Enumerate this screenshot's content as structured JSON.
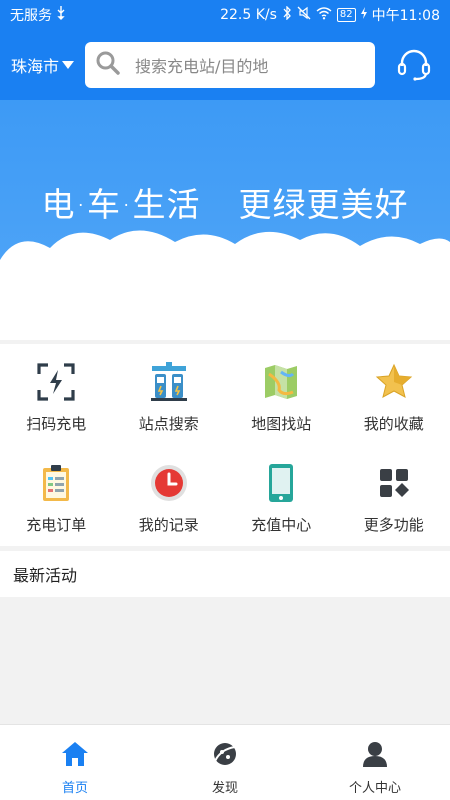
{
  "status_bar": {
    "carrier": "无服务",
    "speed": "22.5 K/s",
    "battery": "82",
    "time": "中午11:08"
  },
  "header": {
    "city": "珠海市",
    "search_placeholder": "搜索充电站/目的地"
  },
  "banner": {
    "slogan_left": "电·车·生活",
    "slogan_right": "更绿更美好"
  },
  "grid": {
    "items": [
      {
        "label": "扫码充电",
        "icon": "scan-charge-icon"
      },
      {
        "label": "站点搜索",
        "icon": "station-search-icon"
      },
      {
        "label": "地图找站",
        "icon": "map-icon"
      },
      {
        "label": "我的收藏",
        "icon": "star-icon"
      },
      {
        "label": "充电订单",
        "icon": "clipboard-icon"
      },
      {
        "label": "我的记录",
        "icon": "clock-icon"
      },
      {
        "label": "充值中心",
        "icon": "tablet-icon"
      },
      {
        "label": "更多功能",
        "icon": "more-grid-icon"
      }
    ]
  },
  "news": {
    "title": "最新活动"
  },
  "tabbar": {
    "tabs": [
      {
        "label": "首页",
        "active": true
      },
      {
        "label": "发现",
        "active": false
      },
      {
        "label": "个人中心",
        "active": false
      }
    ]
  },
  "colors": {
    "brand": "#1a80f2",
    "banner_sky": "#4aa2f7"
  }
}
